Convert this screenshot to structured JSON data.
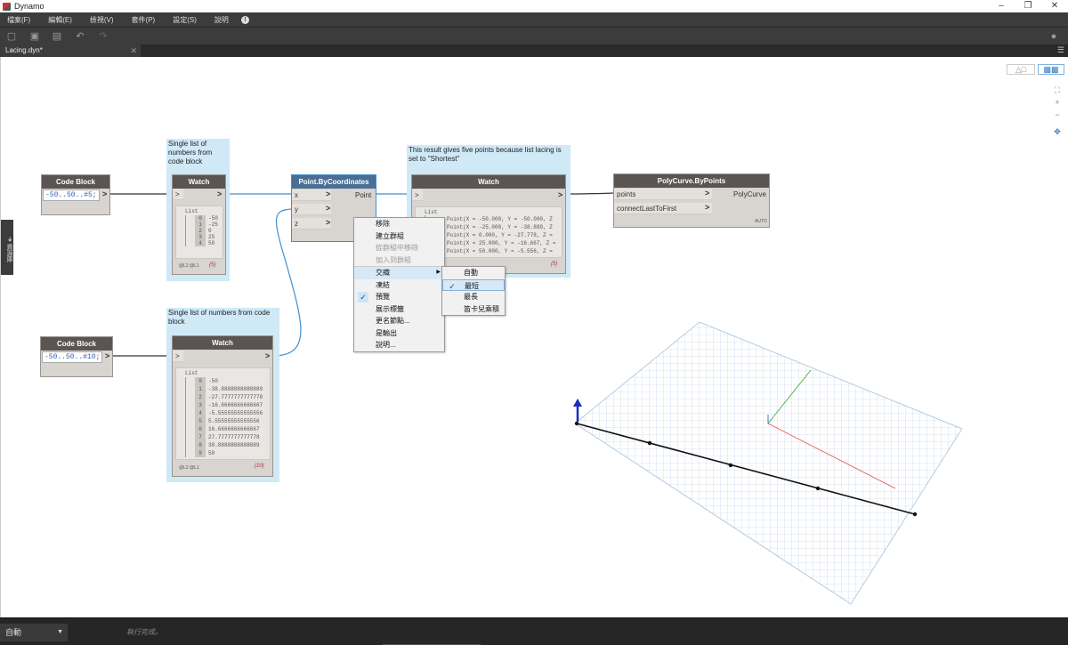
{
  "app": {
    "title": "Dynamo"
  },
  "menu": [
    "檔案(F)",
    "編輯(E)",
    "檢視(V)",
    "套件(P)",
    "設定(S)",
    "說明"
  ],
  "tab": {
    "label": "Lacing.dyn*"
  },
  "library_label": "資源庫",
  "groups": {
    "g1": "Single list of numbers from code block",
    "g2": "Single list of numbers from code block",
    "g3": "This result gives five points because list lacing is set to \"Shortest\""
  },
  "nodes": {
    "cb1": {
      "title": "Code Block",
      "code": "-50..50..#5;"
    },
    "cb2": {
      "title": "Code Block",
      "code": "-50..50..#10;"
    },
    "watch1": {
      "title": "Watch",
      "list_label": "List",
      "items": [
        {
          "i": "0",
          "v": "-50"
        },
        {
          "i": "1",
          "v": "-25"
        },
        {
          "i": "2",
          "v": "0"
        },
        {
          "i": "3",
          "v": "25"
        },
        {
          "i": "4",
          "v": "50"
        }
      ],
      "levels": "@L2 @L1",
      "count": "{5}"
    },
    "watch2": {
      "title": "Watch",
      "list_label": "List",
      "items": [
        {
          "i": "0",
          "v": "-50"
        },
        {
          "i": "1",
          "v": "-38.8888888888889"
        },
        {
          "i": "2",
          "v": "-27.7777777777778"
        },
        {
          "i": "3",
          "v": "-16.6666666666667"
        },
        {
          "i": "4",
          "v": "-5.55555555555556"
        },
        {
          "i": "5",
          "v": "5.55555555555556"
        },
        {
          "i": "6",
          "v": "16.6666666666667"
        },
        {
          "i": "7",
          "v": "27.7777777777778"
        },
        {
          "i": "8",
          "v": "38.8888888888889"
        },
        {
          "i": "9",
          "v": "50"
        }
      ],
      "levels": "@L2 @L1",
      "count": "{10}"
    },
    "point": {
      "title": "Point.ByCoordinates",
      "in": [
        "x",
        "y",
        "z"
      ],
      "out": "Point"
    },
    "watch3": {
      "title": "Watch",
      "list_label": "List",
      "items": [
        "Point(X = -50.000, Y = -50.000, Z",
        "Point(X = -25.000, Y = -38.889, Z",
        "Point(X = 0.000, Y = -27.778, Z =",
        "Point(X = 25.000, Y = -16.667, Z =",
        "Point(X = 50.000, Y = -5.556, Z ="
      ],
      "count": "{5}"
    },
    "polycurve": {
      "title": "PolyCurve.ByPoints",
      "in": [
        "points",
        "connectLastToFirst"
      ],
      "out": "PolyCurve",
      "badge": "AUTO"
    }
  },
  "context_menu": {
    "items": [
      {
        "label": "移除",
        "disabled": false
      },
      {
        "label": "建立群組",
        "disabled": false
      },
      {
        "label": "從群組中移除",
        "disabled": true
      },
      {
        "label": "加入到群組",
        "disabled": true
      },
      {
        "label": "交織",
        "disabled": false,
        "submenu": true,
        "highlighted": true
      },
      {
        "label": "凍結",
        "disabled": false
      },
      {
        "label": "預覽",
        "disabled": false,
        "checked": true
      },
      {
        "label": "展示標籤",
        "disabled": false
      },
      {
        "label": "更名節點...",
        "disabled": false
      },
      {
        "label": "是輸出",
        "disabled": false
      },
      {
        "label": "說明...",
        "disabled": false
      }
    ],
    "submenu": [
      {
        "label": "自動",
        "checked": false
      },
      {
        "label": "最短",
        "checked": true
      },
      {
        "label": "最長",
        "checked": false
      },
      {
        "label": "笛卡兒乘積",
        "checked": false
      }
    ]
  },
  "status": {
    "run_mode": "自動",
    "message": "執行完成。"
  },
  "colors": {
    "node_header": "#5a5552",
    "group_bg": "#cfe9f7",
    "wire": "#3d8fcf",
    "chrome": "#3c3c3c"
  }
}
